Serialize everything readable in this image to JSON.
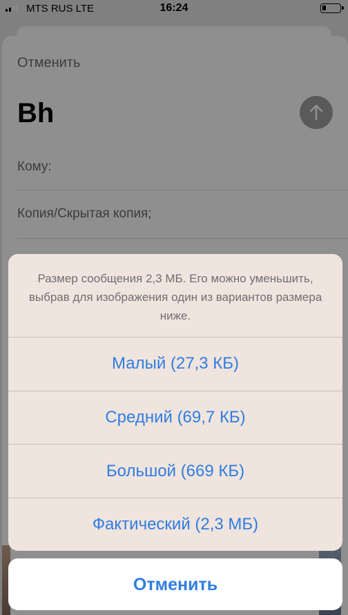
{
  "status_bar": {
    "carrier": "MTS RUS  LTE",
    "time": "16:24",
    "signal_bars": 2,
    "signal_max": 4
  },
  "compose": {
    "cancel_label": "Отменить",
    "subject": "Bh",
    "to_label": "Кому:",
    "cc_label": "Копия/Скрытая копия;",
    "send_icon": "arrow-up-icon"
  },
  "action_sheet": {
    "message": "Размер сообщения 2,3 МБ. Его можно уменьшить, выбрав для изображения один из вариантов размера ниже.",
    "options": [
      {
        "label": "Малый (27,3 КБ)"
      },
      {
        "label": "Средний (69,7 КБ)"
      },
      {
        "label": "Большой (669 КБ)"
      },
      {
        "label": "Фактический (2,3 МБ)"
      }
    ],
    "cancel_label": "Отменить"
  },
  "colors": {
    "accent": "#2f7de1",
    "dimmed_background": "#8f8f8f",
    "sheet_background": "#f0e4de"
  }
}
